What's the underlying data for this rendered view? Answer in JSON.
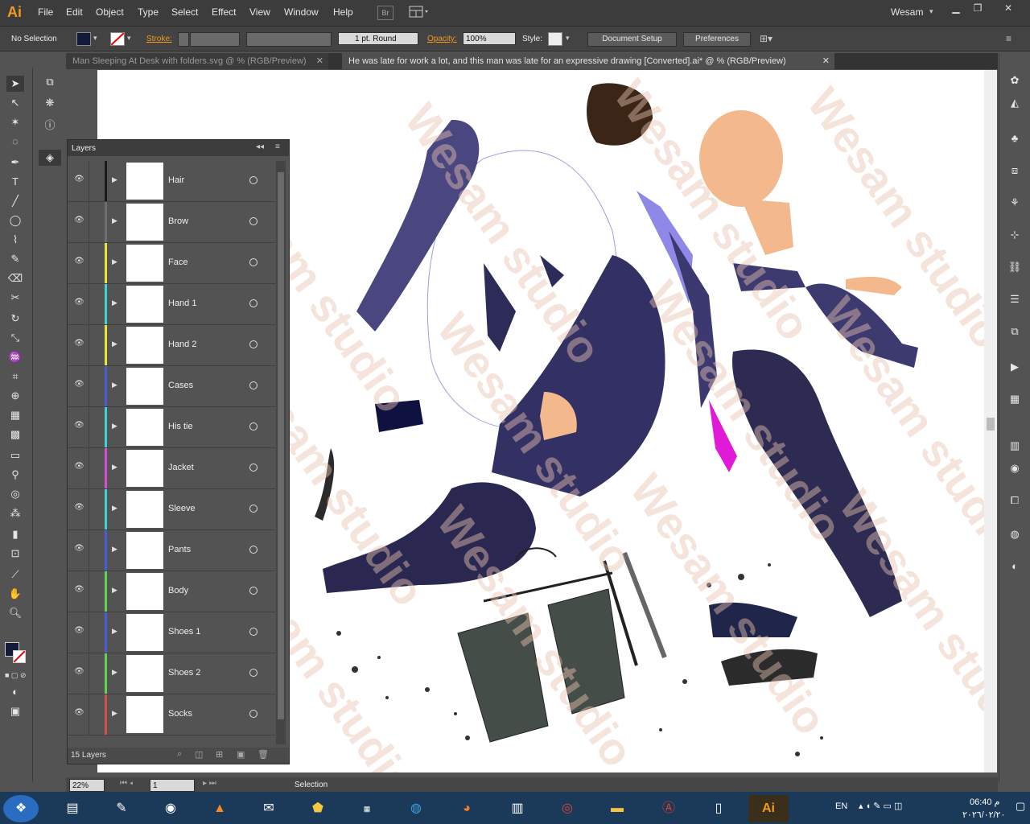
{
  "app": {
    "logo": "Ai",
    "user": "Wesam",
    "bridge_label": "Br"
  },
  "menu": [
    "File",
    "Edit",
    "Object",
    "Type",
    "Select",
    "Effect",
    "View",
    "Window",
    "Help"
  ],
  "control": {
    "selection_status": "No Selection",
    "stroke_label": "Stroke:",
    "brush_value": "1 pt. Round",
    "opacity_label": "Opacity:",
    "opacity_value": "100%",
    "style_label": "Style:",
    "document_setup": "Document Setup",
    "preferences": "Preferences"
  },
  "tabs": [
    {
      "label": "Man Sleeping At Desk with folders.svg @ % (RGB/Preview)",
      "active": false
    },
    {
      "label": "He was late for work a lot, and this man was late for an expressive drawing [Converted].ai* @ % (RGB/Preview)",
      "active": true
    }
  ],
  "layers_panel": {
    "title": "Layers",
    "count": "15 Layers",
    "layers": [
      {
        "name": "Hair",
        "color": "#1a1a1a"
      },
      {
        "name": "Brow",
        "color": "#6e6e6e"
      },
      {
        "name": "Face",
        "color": "#ede634"
      },
      {
        "name": "Hand 1",
        "color": "#3fd4d4"
      },
      {
        "name": "Hand 2",
        "color": "#ede634"
      },
      {
        "name": "Cases",
        "color": "#4a5bd9"
      },
      {
        "name": "His tie",
        "color": "#3fd4d4"
      },
      {
        "name": "Jacket",
        "color": "#d44fd4"
      },
      {
        "name": "Sleeve",
        "color": "#3fd4d4"
      },
      {
        "name": "Pants",
        "color": "#4a5bd9"
      },
      {
        "name": "Body",
        "color": "#5ed44f"
      },
      {
        "name": "Shoes 1",
        "color": "#4a5bd9"
      },
      {
        "name": "Shoes 2",
        "color": "#5ed44f"
      },
      {
        "name": "Socks",
        "color": "#d44f4f"
      }
    ]
  },
  "status": {
    "zoom": "22%",
    "page": "1",
    "tool": "Selection"
  },
  "watermark": "Wesam studio",
  "taskbar": {
    "language": "EN",
    "time": "06:40 م",
    "date": "٢٠٢٦/٠٢/٢٠"
  },
  "colors": {
    "fill": "#111a3a",
    "accent": "#f29b1d",
    "suit": "#3d3a70",
    "tie": "#e01ad6",
    "skin": "#f3b98c"
  }
}
